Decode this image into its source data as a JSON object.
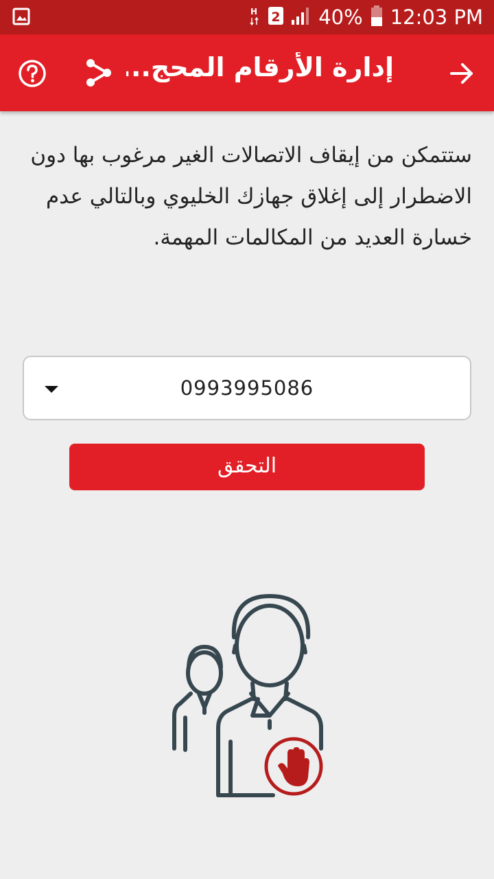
{
  "status_bar": {
    "network": "H",
    "sim": "2",
    "battery": "40%",
    "time": "12:03 PM"
  },
  "app_bar": {
    "title": "إدارة الأرقام المحج...",
    "icons": [
      "help-icon",
      "share-icon",
      "back-arrow-icon"
    ]
  },
  "main": {
    "description": "ستتمكن من إيقاف الاتصالات الغير مرغوب بها دون الاضطرار إلى إغلاق جهازك الخليوي وبالتالي عدم خسارة العديد من المكالمات المهمة.",
    "phone_number": "0993995086",
    "verify_label": "التحقق"
  },
  "colors": {
    "primary": "#e21f26",
    "status_bar": "#b71c1c",
    "background": "#eeeeee",
    "illustration_stroke": "#37474f",
    "stop_badge": "#b71c1c"
  }
}
